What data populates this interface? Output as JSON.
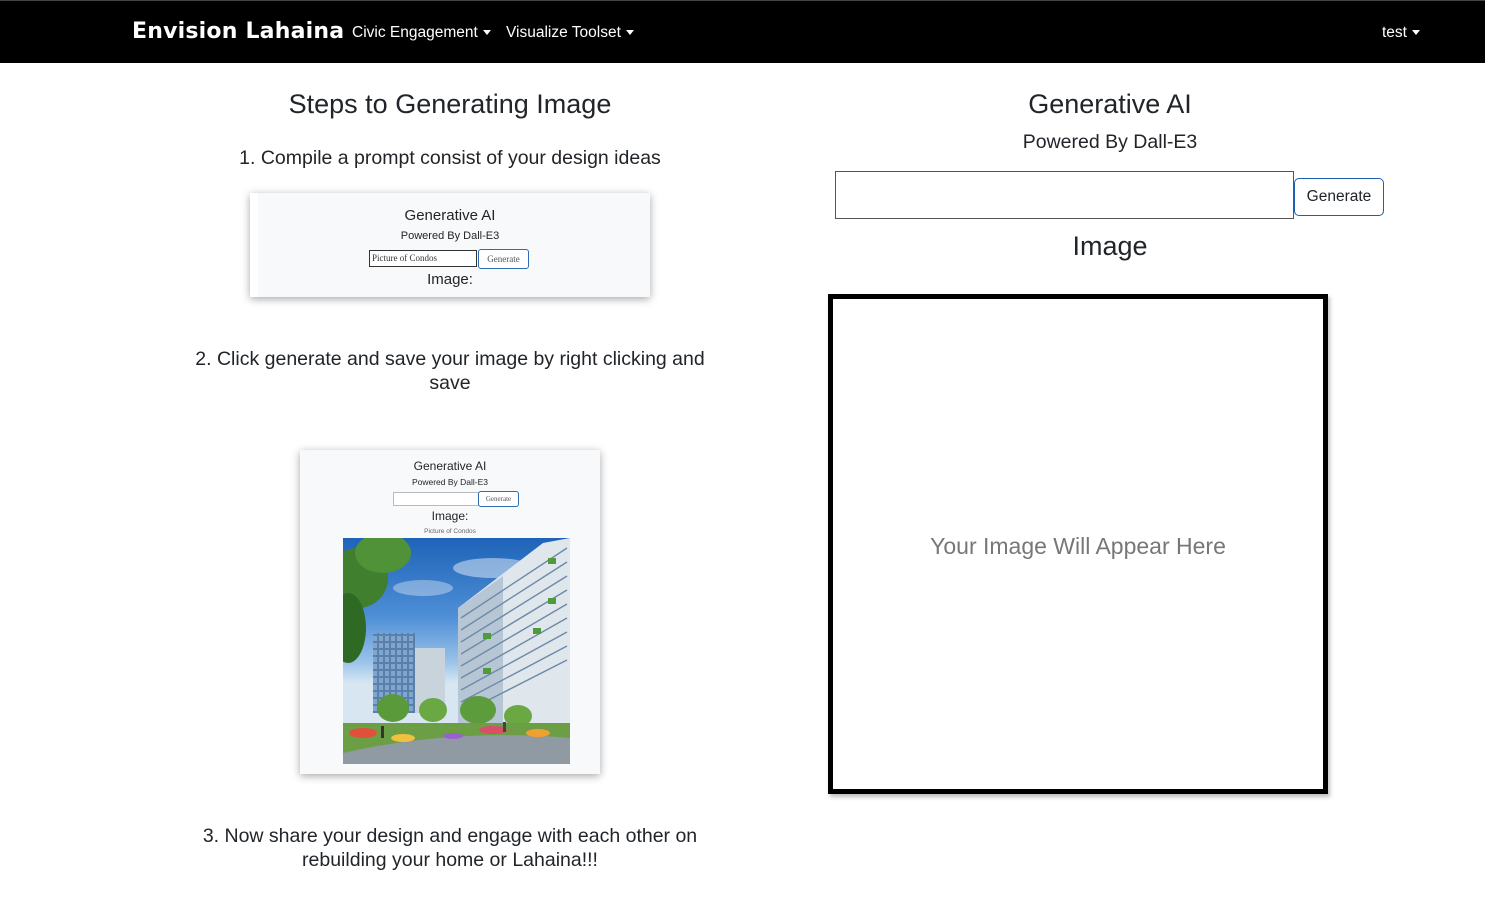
{
  "navbar": {
    "brand": "Envision Lahaina",
    "menu": [
      "Civic Engagement",
      "Visualize Toolset"
    ],
    "user": "test"
  },
  "steps": {
    "heading": "Steps to Generating Image",
    "step1": "1. Compile a prompt consist of your design ideas",
    "step2": "2. Click generate and save your image by right clicking and save",
    "step3": "3. Now share your design and engage with each other on rebuilding your home or Lahaina!!!"
  },
  "example1": {
    "title": "Generative AI",
    "subtitle": "Powered By Dall-E3",
    "input_value": "Picture of Condos",
    "button": "Generate",
    "image_label": "Image:"
  },
  "example2": {
    "title": "Generative AI",
    "subtitle": "Powered By Dall-E3",
    "button": "Generate",
    "image_label": "Image:",
    "caption": "Picture of Condos"
  },
  "generator": {
    "title": "Generative AI",
    "subtitle": "Powered By Dall-E3",
    "input_value": "",
    "button": "Generate",
    "image_heading": "Image",
    "placeholder": "Your Image Will Appear Here"
  },
  "colors": {
    "navbar_bg": "#000000",
    "button_border": "#1b5fb0",
    "placeholder_text": "#777777"
  },
  "icons": [
    "caret-down-icon"
  ]
}
